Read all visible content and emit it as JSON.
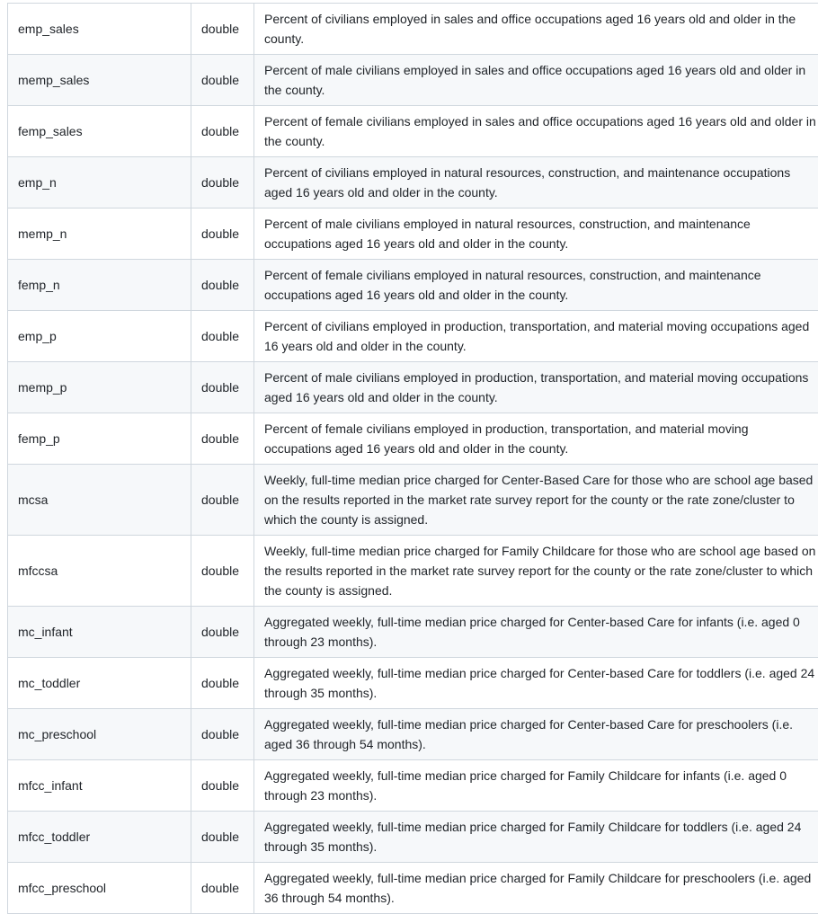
{
  "table": {
    "rows": [
      {
        "variable": "emp_sales",
        "type": "double",
        "description": "Percent of civilians employed in sales and office occupations aged 16 years old and older in the county."
      },
      {
        "variable": "memp_sales",
        "type": "double",
        "description": "Percent of male civilians employed in sales and office occupations aged 16 years old and older in the county."
      },
      {
        "variable": "femp_sales",
        "type": "double",
        "description": "Percent of female civilians employed in sales and office occupations aged 16 years old and older in the county."
      },
      {
        "variable": "emp_n",
        "type": "double",
        "description": "Percent of civilians employed in natural resources, construction, and maintenance occupations aged 16 years old and older in the county."
      },
      {
        "variable": "memp_n",
        "type": "double",
        "description": "Percent of male civilians employed in natural resources, construction, and maintenance occupations aged 16 years old and older in the county."
      },
      {
        "variable": "femp_n",
        "type": "double",
        "description": "Percent of female civilians employed in natural resources, construction, and maintenance occupations aged 16 years old and older in the county."
      },
      {
        "variable": "emp_p",
        "type": "double",
        "description": "Percent of civilians employed in production, transportation, and material moving occupations aged 16 years old and older in the county."
      },
      {
        "variable": "memp_p",
        "type": "double",
        "description": "Percent of male civilians employed in production, transportation, and material moving occupations aged 16 years old and older in the county."
      },
      {
        "variable": "femp_p",
        "type": "double",
        "description": "Percent of female civilians employed in production, transportation, and material moving occupations aged 16 years old and older in the county."
      },
      {
        "variable": "mcsa",
        "type": "double",
        "description": "Weekly, full-time median price charged for Center-Based Care for those who are school age based on the results reported in the market rate survey report for the county or the rate zone/cluster to which the county is assigned."
      },
      {
        "variable": "mfccsa",
        "type": "double",
        "description": "Weekly, full-time median price charged for Family Childcare for those who are school age based on the results reported in the market rate survey report for the county or the rate zone/cluster to which the county is assigned."
      },
      {
        "variable": "mc_infant",
        "type": "double",
        "description": "Aggregated weekly, full-time median price charged for Center-based Care for infants (i.e. aged 0 through 23 months)."
      },
      {
        "variable": "mc_toddler",
        "type": "double",
        "description": "Aggregated weekly, full-time median price charged for Center-based Care for toddlers (i.e. aged 24 through 35 months)."
      },
      {
        "variable": "mc_preschool",
        "type": "double",
        "description": "Aggregated weekly, full-time median price charged for Center-based Care for preschoolers (i.e. aged 36 through 54 months)."
      },
      {
        "variable": "mfcc_infant",
        "type": "double",
        "description": "Aggregated weekly, full-time median price charged for Family Childcare for infants (i.e. aged 0 through 23 months)."
      },
      {
        "variable": "mfcc_toddler",
        "type": "double",
        "description": "Aggregated weekly, full-time median price charged for Family Childcare for toddlers (i.e. aged 24 through 35 months)."
      },
      {
        "variable": "mfcc_preschool",
        "type": "double",
        "description": "Aggregated weekly, full-time median price charged for Family Childcare for preschoolers (i.e. aged 36 through 54 months)."
      }
    ]
  }
}
